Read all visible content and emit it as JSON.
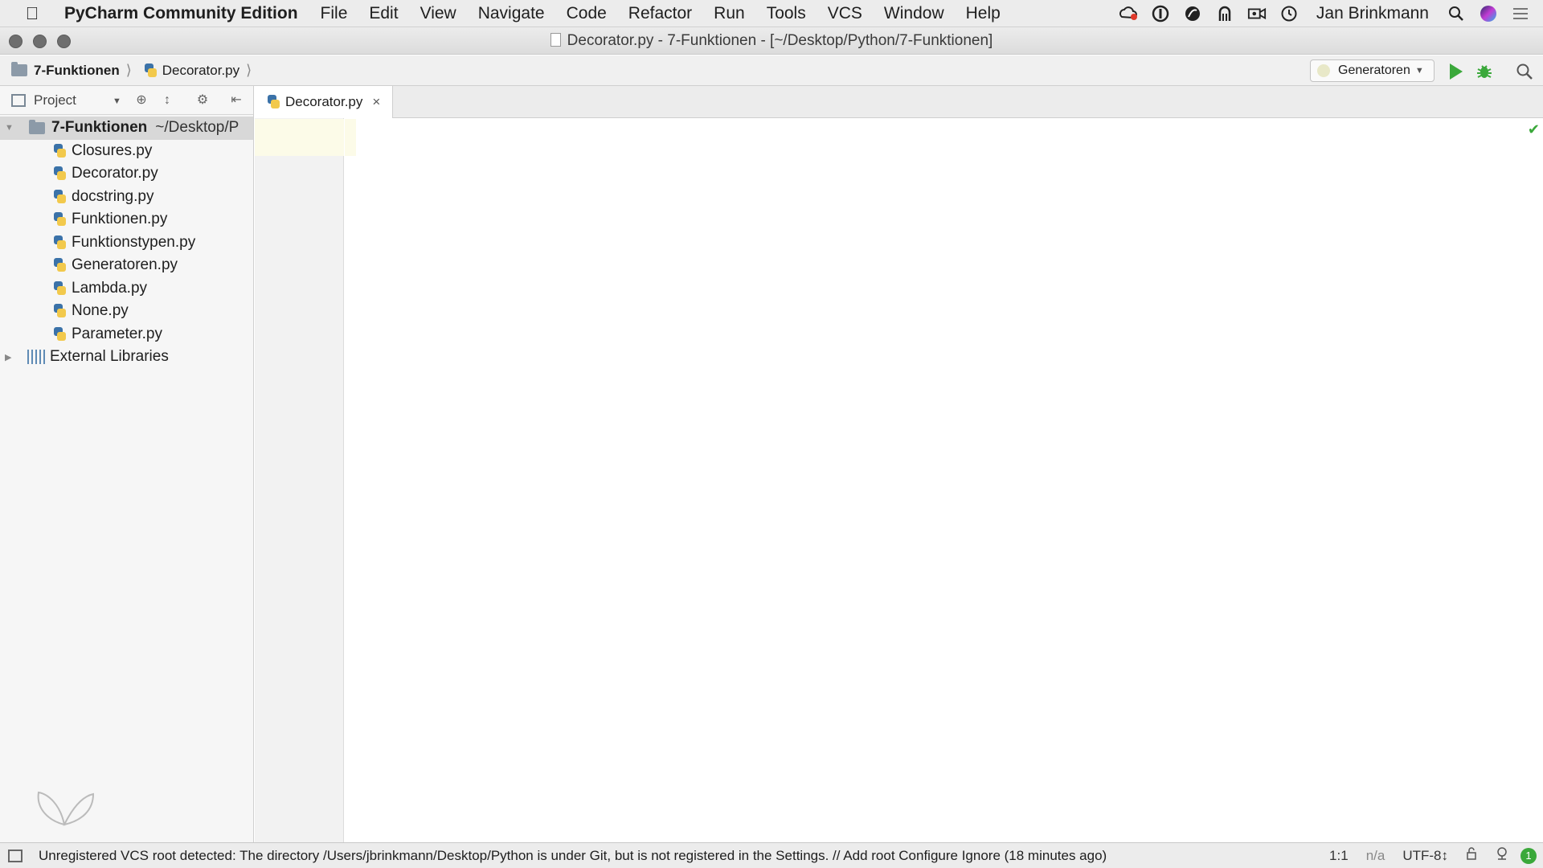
{
  "menubar": {
    "app_name": "PyCharm Community Edition",
    "items": [
      "File",
      "Edit",
      "View",
      "Navigate",
      "Code",
      "Refactor",
      "Run",
      "Tools",
      "VCS",
      "Window",
      "Help"
    ],
    "user": "Jan Brinkmann",
    "tray_icons": [
      "creative-cloud-icon",
      "1password-icon",
      "scrivener-icon",
      "fuse-icon",
      "screen-recorder-icon",
      "time-machine-icon"
    ]
  },
  "window": {
    "title": "Decorator.py - 7-Funktionen - [~/Desktop/Python/7-Funktionen]"
  },
  "navbar": {
    "breadcrumb": [
      "7-Funktionen",
      "Decorator.py"
    ],
    "run_config": "Generatoren"
  },
  "project_panel": {
    "view_label": "Project",
    "root": {
      "name": "7-Funktionen",
      "path": "~/Desktop/P"
    },
    "files": [
      "Closures.py",
      "Decorator.py",
      "docstring.py",
      "Funktionen.py",
      "Funktionstypen.py",
      "Generatoren.py",
      "Lambda.py",
      "None.py",
      "Parameter.py"
    ],
    "external_libraries": "External Libraries"
  },
  "editor": {
    "tabs": [
      {
        "label": "Decorator.py",
        "close": "×"
      }
    ],
    "inspection_status": "✔"
  },
  "statusbar": {
    "message": "Unregistered VCS root detected: The directory /Users/jbrinkmann/Desktop/Python is under Git, but is not registered in the Settings. // Add root  Configure  Ignore (18 minutes ago)",
    "position": "1:1",
    "na": "n/a",
    "encoding": "UTF-8↕",
    "notifications_count": "1"
  },
  "colors": {
    "run_green": "#3aa83a",
    "python_blue": "#3b72a8",
    "python_yellow": "#f2c94c",
    "selection_gray": "#d8d8d8"
  }
}
